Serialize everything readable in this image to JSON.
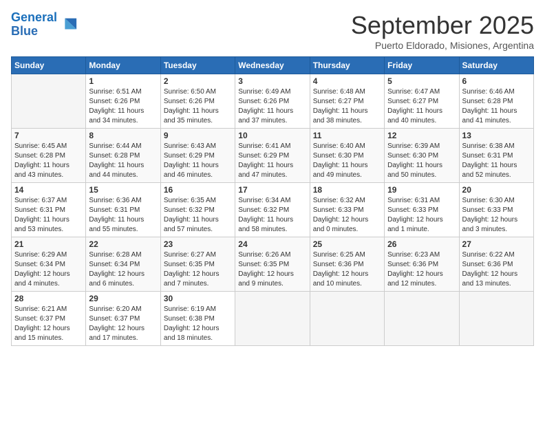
{
  "logo": {
    "line1": "General",
    "line2": "Blue"
  },
  "title": "September 2025",
  "subtitle": "Puerto Eldorado, Misiones, Argentina",
  "weekdays": [
    "Sunday",
    "Monday",
    "Tuesday",
    "Wednesday",
    "Thursday",
    "Friday",
    "Saturday"
  ],
  "weeks": [
    [
      {
        "day": "",
        "info": ""
      },
      {
        "day": "1",
        "info": "Sunrise: 6:51 AM\nSunset: 6:26 PM\nDaylight: 11 hours\nand 34 minutes."
      },
      {
        "day": "2",
        "info": "Sunrise: 6:50 AM\nSunset: 6:26 PM\nDaylight: 11 hours\nand 35 minutes."
      },
      {
        "day": "3",
        "info": "Sunrise: 6:49 AM\nSunset: 6:26 PM\nDaylight: 11 hours\nand 37 minutes."
      },
      {
        "day": "4",
        "info": "Sunrise: 6:48 AM\nSunset: 6:27 PM\nDaylight: 11 hours\nand 38 minutes."
      },
      {
        "day": "5",
        "info": "Sunrise: 6:47 AM\nSunset: 6:27 PM\nDaylight: 11 hours\nand 40 minutes."
      },
      {
        "day": "6",
        "info": "Sunrise: 6:46 AM\nSunset: 6:28 PM\nDaylight: 11 hours\nand 41 minutes."
      }
    ],
    [
      {
        "day": "7",
        "info": "Sunrise: 6:45 AM\nSunset: 6:28 PM\nDaylight: 11 hours\nand 43 minutes."
      },
      {
        "day": "8",
        "info": "Sunrise: 6:44 AM\nSunset: 6:28 PM\nDaylight: 11 hours\nand 44 minutes."
      },
      {
        "day": "9",
        "info": "Sunrise: 6:43 AM\nSunset: 6:29 PM\nDaylight: 11 hours\nand 46 minutes."
      },
      {
        "day": "10",
        "info": "Sunrise: 6:41 AM\nSunset: 6:29 PM\nDaylight: 11 hours\nand 47 minutes."
      },
      {
        "day": "11",
        "info": "Sunrise: 6:40 AM\nSunset: 6:30 PM\nDaylight: 11 hours\nand 49 minutes."
      },
      {
        "day": "12",
        "info": "Sunrise: 6:39 AM\nSunset: 6:30 PM\nDaylight: 11 hours\nand 50 minutes."
      },
      {
        "day": "13",
        "info": "Sunrise: 6:38 AM\nSunset: 6:31 PM\nDaylight: 11 hours\nand 52 minutes."
      }
    ],
    [
      {
        "day": "14",
        "info": "Sunrise: 6:37 AM\nSunset: 6:31 PM\nDaylight: 11 hours\nand 53 minutes."
      },
      {
        "day": "15",
        "info": "Sunrise: 6:36 AM\nSunset: 6:31 PM\nDaylight: 11 hours\nand 55 minutes."
      },
      {
        "day": "16",
        "info": "Sunrise: 6:35 AM\nSunset: 6:32 PM\nDaylight: 11 hours\nand 57 minutes."
      },
      {
        "day": "17",
        "info": "Sunrise: 6:34 AM\nSunset: 6:32 PM\nDaylight: 11 hours\nand 58 minutes."
      },
      {
        "day": "18",
        "info": "Sunrise: 6:32 AM\nSunset: 6:33 PM\nDaylight: 12 hours\nand 0 minutes."
      },
      {
        "day": "19",
        "info": "Sunrise: 6:31 AM\nSunset: 6:33 PM\nDaylight: 12 hours\nand 1 minute."
      },
      {
        "day": "20",
        "info": "Sunrise: 6:30 AM\nSunset: 6:33 PM\nDaylight: 12 hours\nand 3 minutes."
      }
    ],
    [
      {
        "day": "21",
        "info": "Sunrise: 6:29 AM\nSunset: 6:34 PM\nDaylight: 12 hours\nand 4 minutes."
      },
      {
        "day": "22",
        "info": "Sunrise: 6:28 AM\nSunset: 6:34 PM\nDaylight: 12 hours\nand 6 minutes."
      },
      {
        "day": "23",
        "info": "Sunrise: 6:27 AM\nSunset: 6:35 PM\nDaylight: 12 hours\nand 7 minutes."
      },
      {
        "day": "24",
        "info": "Sunrise: 6:26 AM\nSunset: 6:35 PM\nDaylight: 12 hours\nand 9 minutes."
      },
      {
        "day": "25",
        "info": "Sunrise: 6:25 AM\nSunset: 6:36 PM\nDaylight: 12 hours\nand 10 minutes."
      },
      {
        "day": "26",
        "info": "Sunrise: 6:23 AM\nSunset: 6:36 PM\nDaylight: 12 hours\nand 12 minutes."
      },
      {
        "day": "27",
        "info": "Sunrise: 6:22 AM\nSunset: 6:36 PM\nDaylight: 12 hours\nand 13 minutes."
      }
    ],
    [
      {
        "day": "28",
        "info": "Sunrise: 6:21 AM\nSunset: 6:37 PM\nDaylight: 12 hours\nand 15 minutes."
      },
      {
        "day": "29",
        "info": "Sunrise: 6:20 AM\nSunset: 6:37 PM\nDaylight: 12 hours\nand 17 minutes."
      },
      {
        "day": "30",
        "info": "Sunrise: 6:19 AM\nSunset: 6:38 PM\nDaylight: 12 hours\nand 18 minutes."
      },
      {
        "day": "",
        "info": ""
      },
      {
        "day": "",
        "info": ""
      },
      {
        "day": "",
        "info": ""
      },
      {
        "day": "",
        "info": ""
      }
    ]
  ]
}
